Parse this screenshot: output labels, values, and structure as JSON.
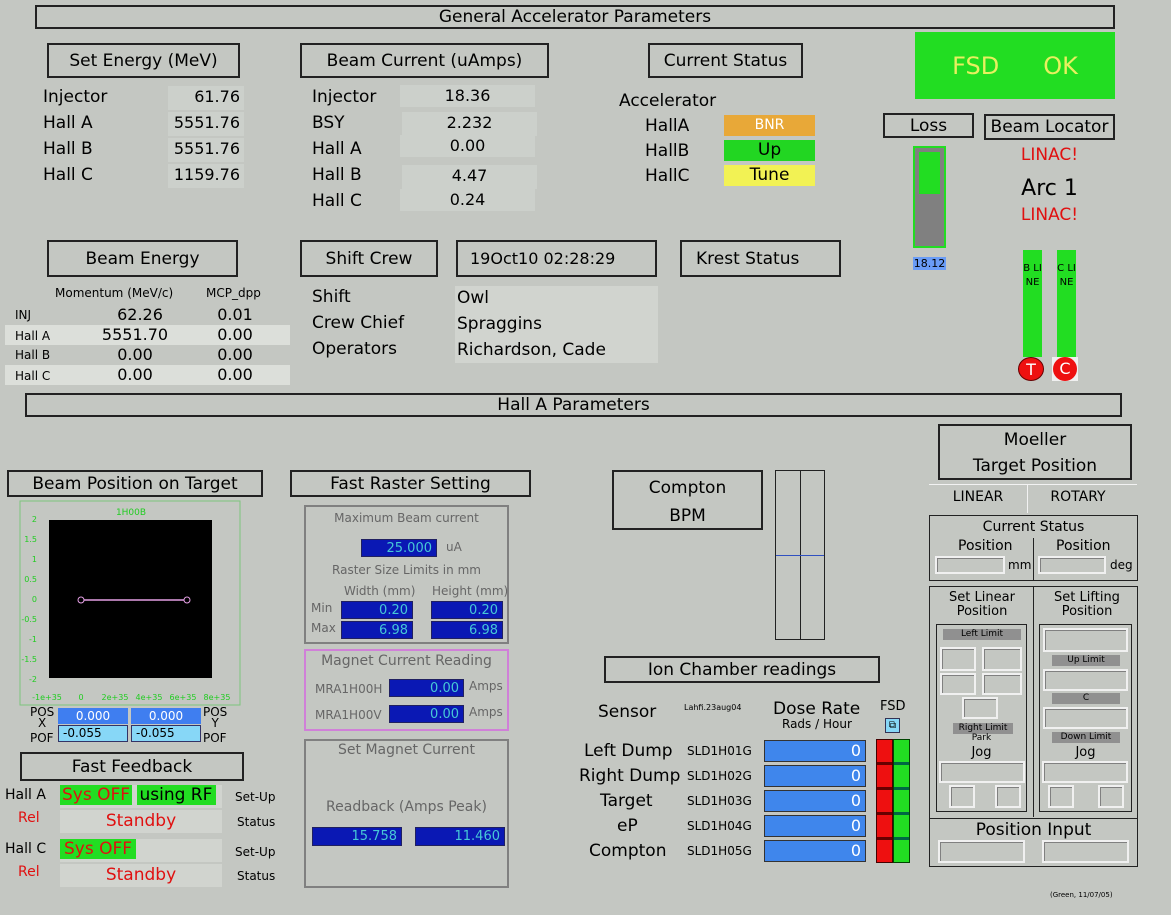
{
  "general": {
    "title": "General Accelerator Parameters"
  },
  "set_energy": {
    "title": "Set Energy (MeV)",
    "rows": [
      {
        "label": "Injector",
        "value": "61.76"
      },
      {
        "label": "Hall A",
        "value": "5551.76"
      },
      {
        "label": "Hall B",
        "value": "5551.76"
      },
      {
        "label": "Hall C",
        "value": "1159.76"
      }
    ]
  },
  "beam_current": {
    "title": "Beam Current (uAmps)",
    "rows": [
      {
        "label": "Injector",
        "value": "18.36"
      },
      {
        "label": "BSY",
        "value": "2.232"
      },
      {
        "label": "Hall A",
        "value": "0.00"
      },
      {
        "label": "Hall B",
        "value": "4.47"
      },
      {
        "label": "Hall C",
        "value": "0.24"
      }
    ]
  },
  "current_status": {
    "title": "Current Status",
    "accelerator": "Accelerator",
    "halls": [
      {
        "label": "HallA",
        "status": "BNR",
        "color": "#e8a838"
      },
      {
        "label": "HallB",
        "status": "Up",
        "color": "#22d622"
      },
      {
        "label": "HallC",
        "status": "Tune",
        "color": "#f2f254"
      }
    ]
  },
  "fsd": {
    "fsd": "FSD",
    "ok": "OK",
    "color": "#22dd22"
  },
  "loss": {
    "title": "Loss",
    "value": "18.12",
    "level": 0.45
  },
  "beam_locator": {
    "title": "Beam Locator",
    "line1": "LINAC!",
    "line2": "Arc 1",
    "line3": "LINAC!",
    "b_line": "B LINE",
    "c_line": "C LINE",
    "b_btn": "T",
    "c_btn": "C"
  },
  "beam_energy": {
    "title": "Beam Energy",
    "col1": "Momentum (MeV/c)",
    "col2": "MCP_dpp",
    "rows": [
      {
        "label": "INJ",
        "mom": "62.26",
        "dpp": "0.01"
      },
      {
        "label": "Hall A",
        "mom": "5551.70",
        "dpp": "0.00"
      },
      {
        "label": "Hall B",
        "mom": "0.00",
        "dpp": "0.00"
      },
      {
        "label": "Hall C",
        "mom": "0.00",
        "dpp": "0.00"
      }
    ]
  },
  "shift_crew": {
    "title": "Shift Crew",
    "labels": [
      "Shift",
      "Crew Chief",
      "Operators"
    ],
    "values": [
      "Owl",
      "Spraggins",
      "Richardson, Cade"
    ]
  },
  "datetime": "19Oct10 02:28:29",
  "krest": {
    "title": "Krest Status"
  },
  "halla": {
    "title": "Hall A Parameters"
  },
  "beam_position": {
    "title": "Beam Position on Target",
    "plot_label": "1H00B",
    "y_ticks": [
      "2",
      "1.5",
      "1",
      "0.5",
      "0",
      "-0.5",
      "-1",
      "-1.5",
      "-2"
    ],
    "x_ticks": [
      "-1e+35",
      "0",
      "2e+35",
      "4e+35",
      "6e+35",
      "8e+35"
    ],
    "pos_x_label": "POS\nX",
    "pof_label": "POF",
    "pos_y_label": "POS\nY",
    "pof2_label": "POF",
    "pos_x": "0.000",
    "pos_y": "0.000",
    "pof_x": "-0.055",
    "pof_y": "-0.055"
  },
  "fast_raster": {
    "title": "Fast Raster Setting",
    "max_current_label": "Maximum Beam current",
    "max_current": "25.000",
    "max_unit": "uA",
    "limits_label": "Raster Size Limits in mm",
    "width_label": "Width (mm)",
    "height_label": "Height (mm)",
    "min_label": "Min",
    "max_label": "Max",
    "min_w": "0.20",
    "min_h": "0.20",
    "max_w": "6.98",
    "max_h": "6.98",
    "magnet_title": "Magnet Current Reading",
    "mag1_label": "MRA1H00H",
    "mag1": "0.00",
    "mag2_label": "MRA1H00V",
    "mag2": "0.00",
    "amps": "Amps",
    "set_title": "Set Magnet Current",
    "readback_label": "Readback (Amps Peak)",
    "rb1": "15.758",
    "rb2": "11.460"
  },
  "fast_feedback": {
    "title": "Fast Feedback",
    "halla_label": "Hall A",
    "rel": "Rel",
    "halla_sys": "Sys OFF",
    "using_rf": "using RF",
    "setup": "Set-Up",
    "status": "Status",
    "standby": "Standby",
    "hallc_label": "Hall C",
    "hallc_sys": "Sys OFF"
  },
  "compton": {
    "title1": "Compton",
    "title2": "BPM"
  },
  "ion_chamber": {
    "title": "Ion Chamber readings",
    "sensor": "Sensor",
    "file": "Lahfi.23aug04",
    "dose_rate": "Dose Rate",
    "rads": "Rads / Hour",
    "fsd": "FSD",
    "rows": [
      {
        "label": "Left Dump",
        "sensor": "SLD1H01G",
        "value": "0"
      },
      {
        "label": "Right Dump",
        "sensor": "SLD1H02G",
        "value": "0"
      },
      {
        "label": "Target",
        "sensor": "SLD1H03G",
        "value": "0"
      },
      {
        "label": "eP",
        "sensor": "SLD1H04G",
        "value": "0"
      },
      {
        "label": "Compton",
        "sensor": "SLD1H05G",
        "value": "0"
      }
    ]
  },
  "moeller": {
    "title1": "Moeller",
    "title2": "Target Position",
    "linear": "LINEAR",
    "rotary": "ROTARY",
    "current_status": "Current Status",
    "position": "Position",
    "mm": "mm",
    "deg": "deg",
    "set_linear": "Set Linear\nPosition",
    "set_lifting": "Set Lifting\nPosition",
    "left_limit": "Left Limit",
    "right_limit": "Right Limit",
    "park": "Park",
    "jog": "Jog",
    "up_limit": "Up Limit",
    "c": "C",
    "down_limit": "Down Limit",
    "position_input": "Position Input"
  },
  "footer": "(Green, 11/07/05)"
}
